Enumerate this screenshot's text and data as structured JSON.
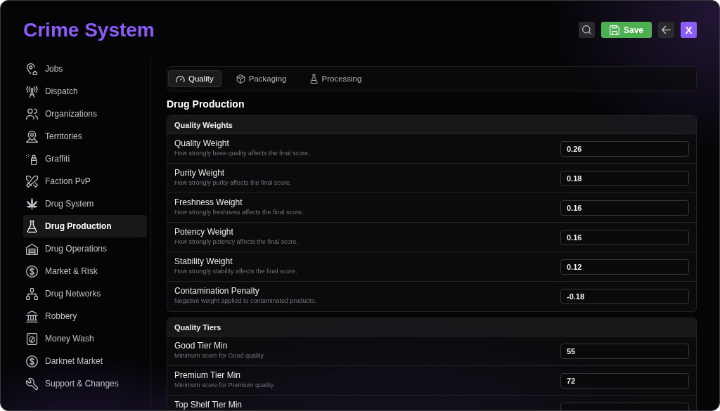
{
  "header": {
    "title": "Crime System",
    "buttons": [
      {
        "kind": "search"
      },
      {
        "kind": "save",
        "label": "Save"
      },
      {
        "kind": "back"
      },
      {
        "kind": "close",
        "label": "X"
      }
    ]
  },
  "sidebar": {
    "items": [
      {
        "label": "Jobs",
        "selected": false
      },
      {
        "label": "Dispatch",
        "selected": false
      },
      {
        "label": "Organizations",
        "selected": false
      },
      {
        "label": "Territories",
        "selected": false
      },
      {
        "label": "Graffiti",
        "selected": false
      },
      {
        "label": "Faction PvP",
        "selected": false
      },
      {
        "label": "Drug System",
        "selected": false
      },
      {
        "label": "Drug Production",
        "selected": true
      },
      {
        "label": "Drug Operations",
        "selected": false
      },
      {
        "label": "Market & Risk",
        "selected": false
      },
      {
        "label": "Drug Networks",
        "selected": false
      },
      {
        "label": "Robbery",
        "selected": false
      },
      {
        "label": "Money Wash",
        "selected": false
      },
      {
        "label": "Darknet Market",
        "selected": false
      },
      {
        "label": "Support & Changes",
        "selected": false
      }
    ]
  },
  "content": {
    "tabs": [
      {
        "label": "Quality",
        "selected": true
      },
      {
        "label": "Packaging",
        "selected": false
      },
      {
        "label": "Processing",
        "selected": false
      }
    ],
    "heading": "Drug Production",
    "sections": [
      {
        "title": "Quality Weights",
        "rows": [
          {
            "label": "Quality Weight",
            "description": "How strongly base quality affects the final score.",
            "value": "0.26"
          },
          {
            "label": "Purity Weight",
            "description": "How strongly purity affects the final score.",
            "value": "0.18"
          },
          {
            "label": "Freshness Weight",
            "description": "How strongly freshness affects the final score.",
            "value": "0.16"
          },
          {
            "label": "Potency Weight",
            "description": "How strongly potency affects the final score.",
            "value": "0.16"
          },
          {
            "label": "Stability Weight",
            "description": "How strongly stability affects the final score.",
            "value": "0.12"
          },
          {
            "label": "Contamination Penalty",
            "description": "Negative weight applied to contaminated products.",
            "value": "-0.18"
          }
        ]
      },
      {
        "title": "Quality Tiers",
        "rows": [
          {
            "label": "Good Tier Min",
            "description": "Minimum score for Good quality.",
            "value": "55"
          },
          {
            "label": "Premium Tier Min",
            "description": "Minimum score for Premium quality.",
            "value": "72"
          },
          {
            "label": "Top Shelf Tier Min"
          }
        ]
      }
    ]
  }
}
